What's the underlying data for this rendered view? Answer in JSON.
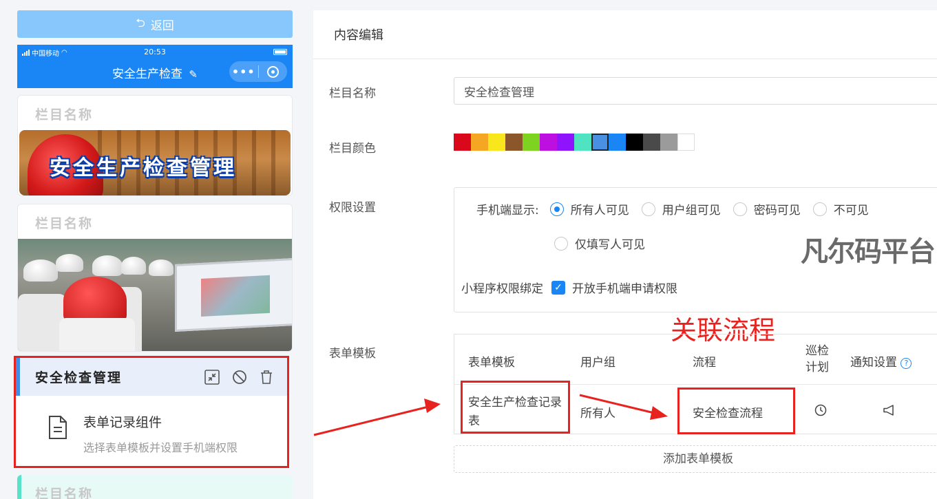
{
  "left": {
    "back_label": "返回",
    "status_bar": {
      "carrier": "中国移动",
      "time": "20:53"
    },
    "phone_title": "安全生产检查",
    "cards": [
      {
        "title": "栏目名称",
        "banner_text": "安全生产检查管理"
      },
      {
        "title": "栏目名称"
      },
      {
        "title": "栏目名称"
      }
    ],
    "selected": {
      "title": "安全检查管理",
      "component_name": "表单记录组件",
      "component_desc": "选择表单模板并设置手机端权限"
    }
  },
  "editor": {
    "header": "内容编辑",
    "fields": {
      "name_label": "栏目名称",
      "name_value": "安全检查管理",
      "color_label": "栏目颜色",
      "perm_label": "权限设置",
      "form_label": "表单模板"
    },
    "colors": [
      "#d9081a",
      "#f5a623",
      "#f8e71c",
      "#8b572a",
      "#7ed321",
      "#bd10e0",
      "#9013fe",
      "#50e3c2",
      "#4a90e2",
      "#1a86f5",
      "#000000",
      "#4a4a4a",
      "#9b9b9b",
      "#ffffff"
    ],
    "selected_color": "#4a90e2",
    "permissions": {
      "mobile_label": "手机端显示:",
      "options": [
        "所有人可见",
        "用户组可见",
        "密码可见",
        "不可见",
        "仅填写人可见"
      ],
      "selected": "所有人可见",
      "bind_label": "小程序权限绑定",
      "bind_option": "开放手机端申请权限",
      "bind_checked": true
    },
    "watermark": "凡尔码平台",
    "annotation": "关联流程",
    "table": {
      "headers": [
        "表单模板",
        "用户组",
        "流程",
        "巡检计划",
        "通知设置"
      ],
      "header_inspect_line1": "巡检",
      "header_inspect_line2": "计划",
      "row": {
        "template_line1": "安全生产检查记录",
        "template_line2": "表",
        "user_group": "所有人",
        "flow": "安全检查流程"
      }
    },
    "add_label": "添加表单模板"
  }
}
